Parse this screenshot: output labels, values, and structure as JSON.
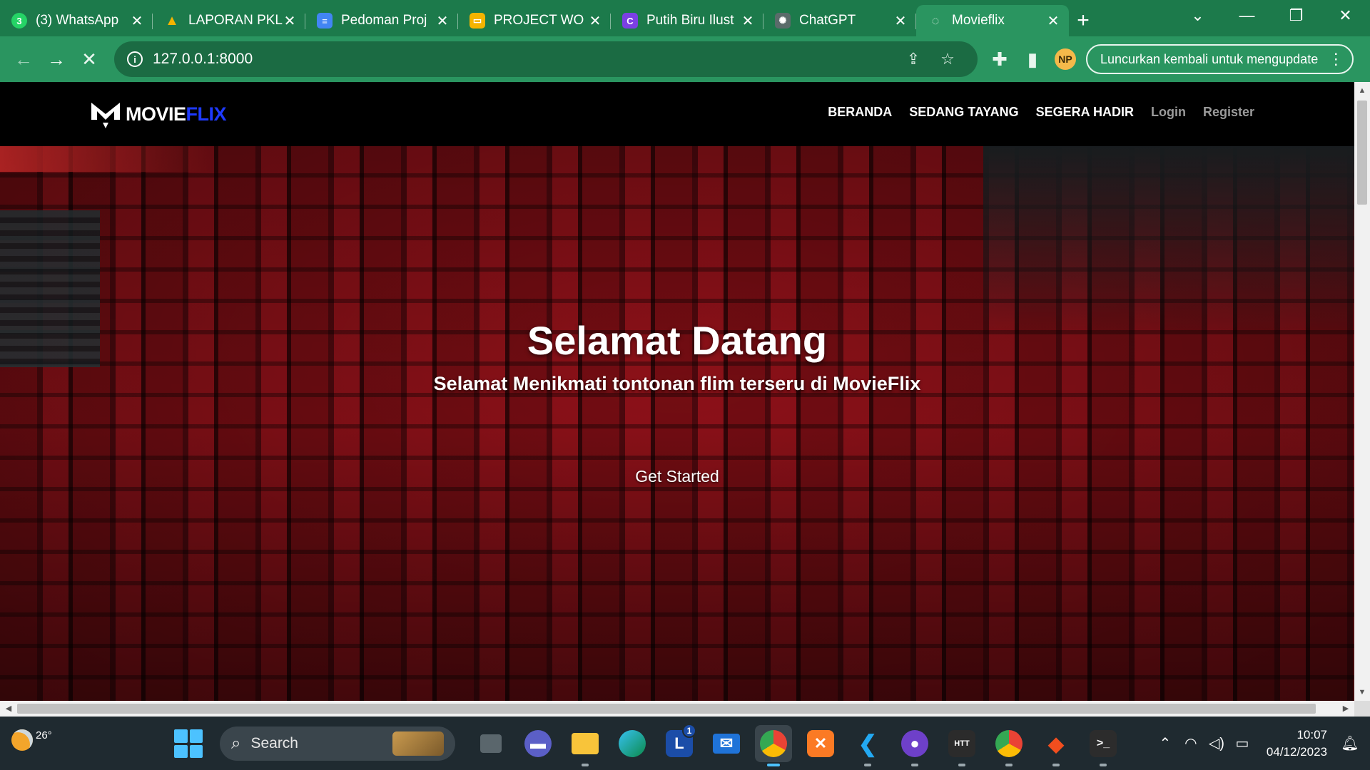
{
  "browser": {
    "tabs": [
      {
        "title": "(3) WhatsApp",
        "favicon": "whatsapp-icon",
        "color": "#25d366",
        "glyph": "3"
      },
      {
        "title": "LAPORAN PKL",
        "favicon": "google-drive-icon",
        "color": "#f4b400",
        "glyph": "▲"
      },
      {
        "title": "Pedoman Proj",
        "favicon": "google-docs-icon",
        "color": "#4285f4",
        "glyph": "≡"
      },
      {
        "title": "PROJECT WO",
        "favicon": "google-slides-icon",
        "color": "#f4b400",
        "glyph": "▭"
      },
      {
        "title": "Putih Biru Ilust",
        "favicon": "canva-icon",
        "color": "#7b3fe4",
        "glyph": "C"
      },
      {
        "title": "ChatGPT",
        "favicon": "chatgpt-icon",
        "color": "#5a6b6a",
        "glyph": "✺"
      },
      {
        "title": "Movieflix",
        "favicon": "loading-icon",
        "color": "#2a9560",
        "glyph": "◌"
      }
    ],
    "new_tab": "+",
    "window_controls": {
      "dropdown": "⌄",
      "minimize": "—",
      "restore": "❐",
      "close": "✕"
    },
    "url": "127.0.0.1:8000",
    "relaunch_label": "Luncurkan kembali untuk mengupdate",
    "profile_initials": "NP"
  },
  "site": {
    "logo_text_1": "MOVIE",
    "logo_text_2": "FLIX",
    "nav": [
      {
        "label": "BERANDA",
        "muted": false
      },
      {
        "label": "SEDANG TAYANG",
        "muted": false
      },
      {
        "label": "SEGERA HADIR",
        "muted": false
      },
      {
        "label": "Login",
        "muted": true
      },
      {
        "label": "Register",
        "muted": true
      }
    ],
    "hero_title": "Selamat Datang",
    "hero_subtitle": "Selamat Menikmati tontonan flim terseru di MovieFlix",
    "cta_label": "Get Started"
  },
  "taskbar": {
    "temperature": "26°",
    "search_label": "Search",
    "time": "10:07",
    "date": "04/12/2023",
    "badge_count": "1"
  }
}
